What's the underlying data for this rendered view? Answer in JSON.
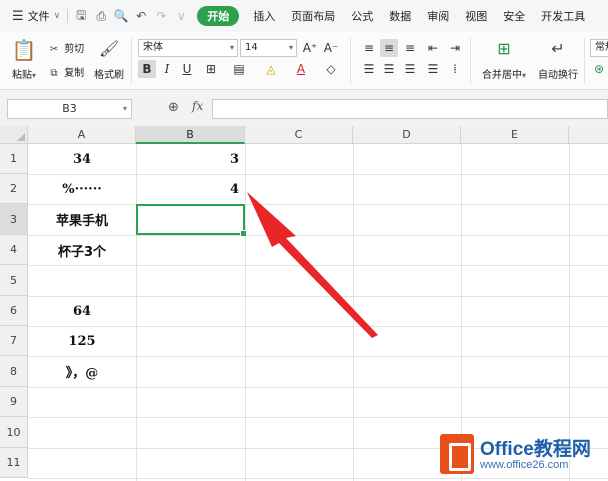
{
  "menubar": {
    "file_label": "文件",
    "tabs": [
      "开始",
      "插入",
      "页面布局",
      "公式",
      "数据",
      "审阅",
      "视图",
      "安全",
      "开发工具"
    ],
    "active_tab": "开始"
  },
  "ribbon": {
    "paste_label": "粘贴",
    "cut_label": "剪切",
    "copy_label": "复制",
    "format_painter_label": "格式刷",
    "font_name": "宋体",
    "font_size": "14",
    "bold_label": "B",
    "italic_label": "I",
    "underline_label": "U",
    "merge_center_label": "合并居中",
    "wrap_text_label": "自动换行",
    "number_format_label": "常规"
  },
  "formula_bar": {
    "name_box": "B3",
    "fx_label": "fx",
    "formula": ""
  },
  "sheet": {
    "columns": [
      "A",
      "B",
      "C",
      "D",
      "E"
    ],
    "selected_column": "B",
    "rows": [
      "1",
      "2",
      "3",
      "4",
      "5",
      "6",
      "7",
      "8",
      "9",
      "10",
      "11"
    ],
    "selected_row": "3",
    "col_a_values": [
      "34",
      "%······",
      "苹果手机",
      "杯子3个",
      "",
      "64",
      "125",
      "》，@",
      "",
      "",
      ""
    ],
    "col_b_values": [
      "3",
      "4",
      "",
      "",
      "",
      "",
      "",
      "",
      "",
      "",
      ""
    ]
  },
  "annotation": {
    "arrow_color": "#e8262a"
  },
  "watermark": {
    "title": "Office教程网",
    "url": "www.office26.com"
  }
}
